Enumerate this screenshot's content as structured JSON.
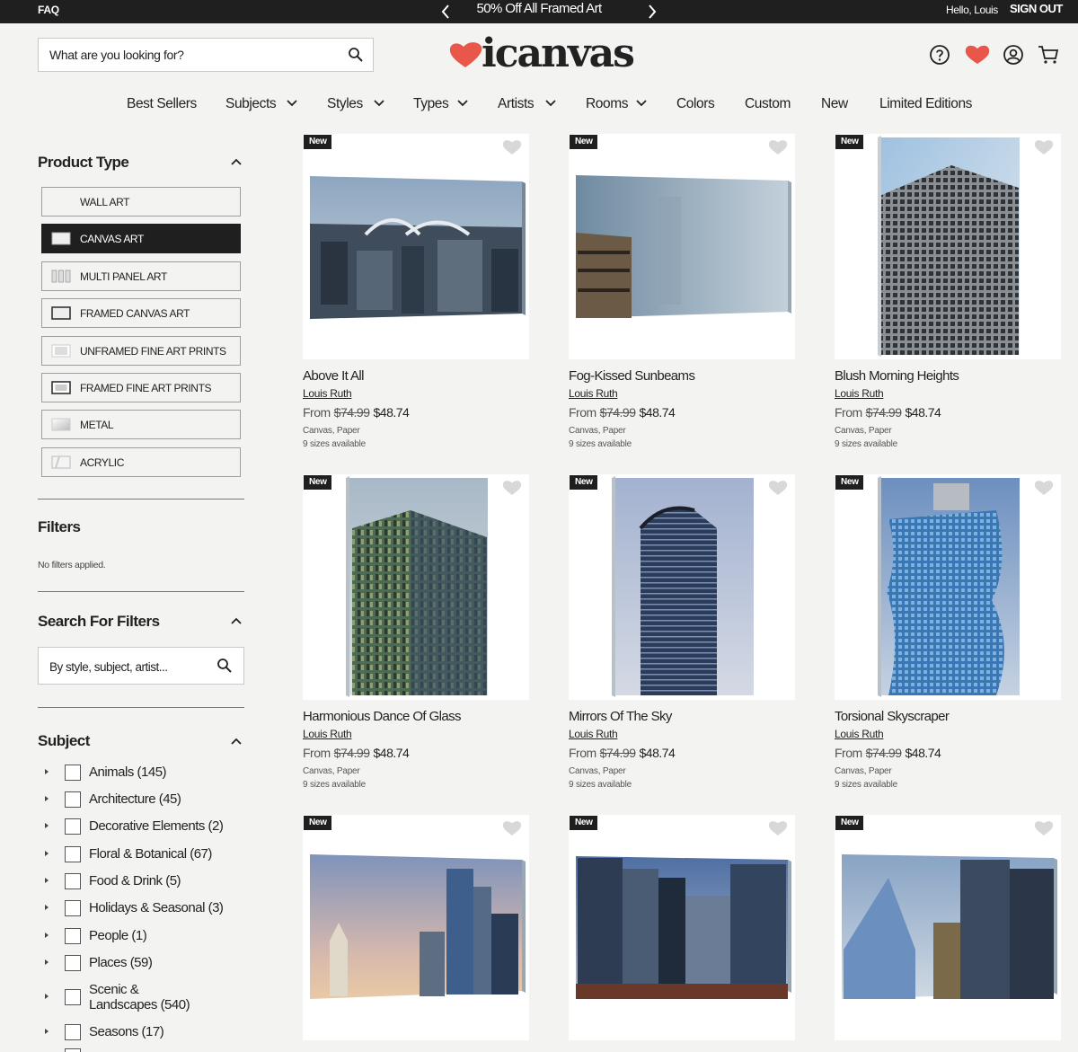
{
  "topbar": {
    "faq": "FAQ",
    "promo": "50% Off All Framed Art",
    "hello": "Hello, Louis",
    "signout": "SIGN OUT"
  },
  "header": {
    "search_placeholder": "What are you looking for?",
    "logo_text": "icanvas",
    "brand_color": "#e8574a"
  },
  "nav": {
    "items": [
      "Best Sellers",
      "Subjects",
      "Styles",
      "Types",
      "Artists",
      "Rooms",
      "Colors",
      "Custom",
      "New",
      "Limited Editions"
    ]
  },
  "sidebar": {
    "product_type_heading": "Product Type",
    "product_types": [
      {
        "label": "WALL ART",
        "icon": "blank-icon",
        "active": false
      },
      {
        "label": "CANVAS ART",
        "icon": "canvas-icon",
        "active": true
      },
      {
        "label": "MULTI PANEL ART",
        "icon": "multi-panel-icon",
        "active": false
      },
      {
        "label": "FRAMED CANVAS ART",
        "icon": "framed-canvas-icon",
        "active": false
      },
      {
        "label": "UNFRAMED FINE ART PRINTS",
        "icon": "unframed-print-icon",
        "active": false
      },
      {
        "label": "FRAMED FINE ART PRINTS",
        "icon": "framed-print-icon",
        "active": false
      },
      {
        "label": "METAL",
        "icon": "metal-icon",
        "active": false
      },
      {
        "label": "ACRYLIC",
        "icon": "acrylic-icon",
        "active": false
      }
    ],
    "filters_heading": "Filters",
    "no_filters": "No filters applied.",
    "search_filters_heading": "Search For Filters",
    "search_filters_placeholder": "By style, subject, artist...",
    "subject_heading": "Subject",
    "subjects": [
      {
        "label": "Animals (145)"
      },
      {
        "label": "Architecture (45)"
      },
      {
        "label": "Decorative Elements (2)"
      },
      {
        "label": "Floral & Botanical (67)"
      },
      {
        "label": "Food & Drink (5)"
      },
      {
        "label": "Holidays & Seasonal (3)"
      },
      {
        "label": "People (1)"
      },
      {
        "label": "Places (59)"
      },
      {
        "label": "Scenic & Landscapes (540)"
      },
      {
        "label": "Seasons (17)"
      }
    ]
  },
  "products": [
    {
      "badge": "New",
      "title": "Above It All",
      "artist": "Louis Ruth",
      "from": "From",
      "old_price": "$74.99",
      "price": "$48.74",
      "materials": "Canvas, Paper",
      "sizes": "9 sizes available"
    },
    {
      "badge": "New",
      "title": "Fog-Kissed Sunbeams",
      "artist": "Louis Ruth",
      "from": "From",
      "old_price": "$74.99",
      "price": "$48.74",
      "materials": "Canvas, Paper",
      "sizes": "9 sizes available"
    },
    {
      "badge": "New",
      "title": "Blush Morning Heights",
      "artist": "Louis Ruth",
      "from": "From",
      "old_price": "$74.99",
      "price": "$48.74",
      "materials": "Canvas, Paper",
      "sizes": "9 sizes available"
    },
    {
      "badge": "New",
      "title": "Harmonious Dance Of Glass",
      "artist": "Louis Ruth",
      "from": "From",
      "old_price": "$74.99",
      "price": "$48.74",
      "materials": "Canvas, Paper",
      "sizes": "9 sizes available"
    },
    {
      "badge": "New",
      "title": "Mirrors Of The Sky",
      "artist": "Louis Ruth",
      "from": "From",
      "old_price": "$74.99",
      "price": "$48.74",
      "materials": "Canvas, Paper",
      "sizes": "9 sizes available"
    },
    {
      "badge": "New",
      "title": "Torsional Skyscraper",
      "artist": "Louis Ruth",
      "from": "From",
      "old_price": "$74.99",
      "price": "$48.74",
      "materials": "Canvas, Paper",
      "sizes": "9 sizes available"
    },
    {
      "badge": "New"
    },
    {
      "badge": "New"
    },
    {
      "badge": "New"
    }
  ]
}
